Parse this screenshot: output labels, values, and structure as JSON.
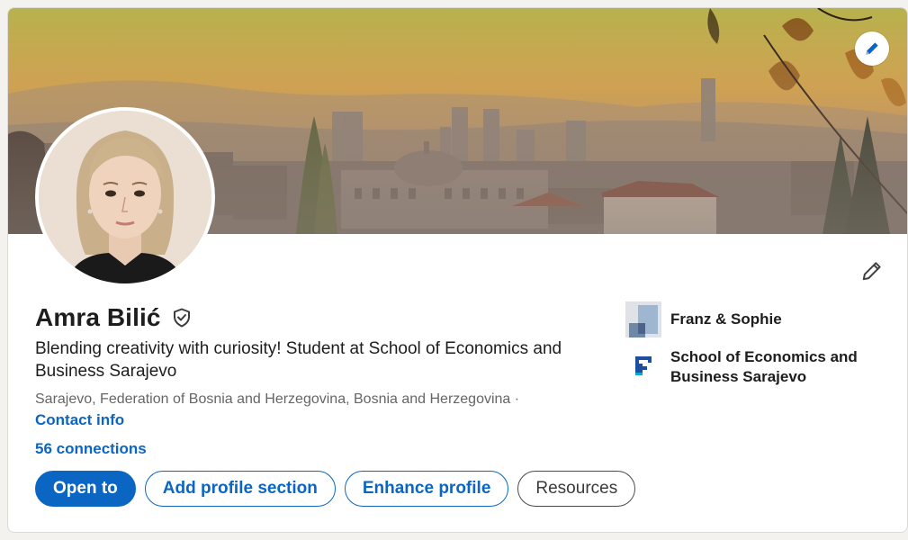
{
  "profile": {
    "name": "Amra Bilić",
    "headline": "Blending creativity with curiosity! Student at School of Economics and Business Sarajevo",
    "location": "Sarajevo, Federation of Bosnia and Herzegovina, Bosnia and Herzegovina ·",
    "contact_info": "Contact info",
    "connections": "56 connections"
  },
  "actions": {
    "open_to": "Open to",
    "add_section": "Add profile section",
    "enhance": "Enhance profile",
    "resources": "Resources"
  },
  "organizations": [
    {
      "name": "Franz & Sophie",
      "icon": "company-logo-icon"
    },
    {
      "name": "School of Economics and Business Sarajevo",
      "icon": "school-logo-icon"
    }
  ],
  "colors": {
    "accent": "#0a66c2",
    "text": "#1d1d1d",
    "muted": "#666666"
  },
  "icons": {
    "banner_edit": "pencil-icon",
    "intro_edit": "pencil-icon",
    "verified": "shield-check-icon"
  }
}
